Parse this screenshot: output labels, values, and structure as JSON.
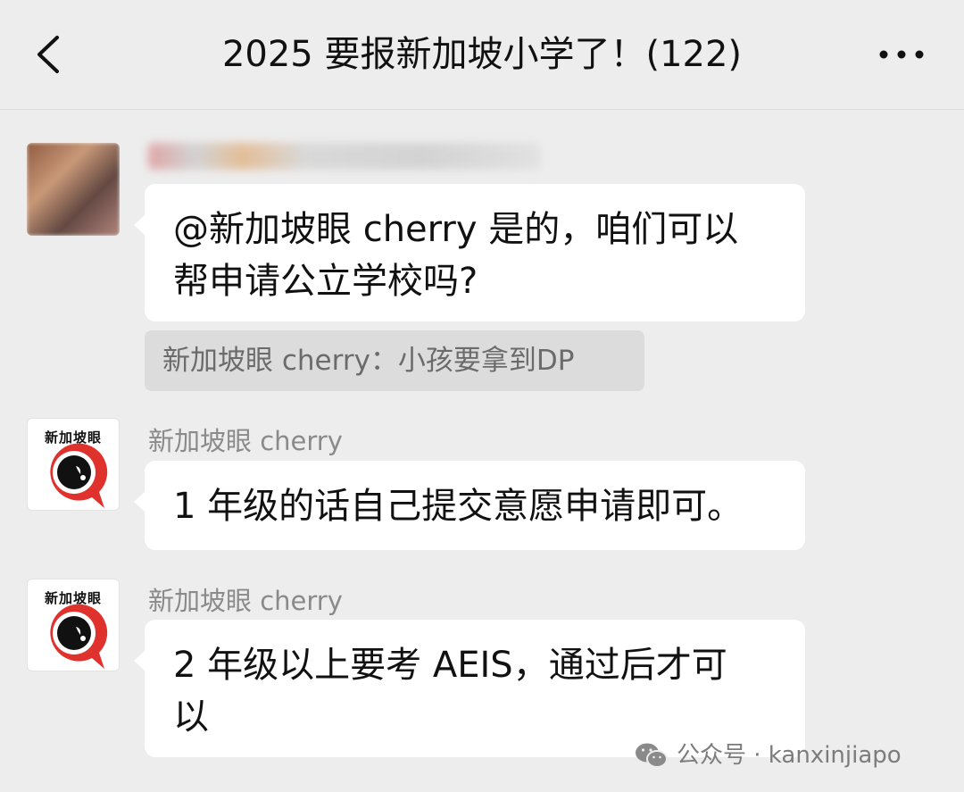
{
  "header": {
    "title": "2025 要报新加坡小学了！(122)"
  },
  "messages": [
    {
      "sender": "",
      "text_line1": "@新加坡眼 cherry 是的，咱们可以",
      "text_line2": "帮申请公立学校吗?",
      "quote": "新加坡眼 cherry：小孩要拿到DP"
    },
    {
      "sender": "新加坡眼 cherry",
      "avatar_text": "新加坡眼",
      "text_line1": "1 年级的话自己提交意愿申请即可。"
    },
    {
      "sender": "新加坡眼 cherry",
      "avatar_text": "新加坡眼",
      "text_line1": "2 年级以上要考 AEIS，通过后才可",
      "text_line2": "以"
    }
  ],
  "watermark": {
    "text": "公众号 · kanxinjiapo"
  },
  "icons": {
    "back": "chevron-left-icon",
    "more": "more-dots-icon",
    "wechat": "wechat-icon"
  },
  "colors": {
    "background": "#ededed",
    "bubble": "#ffffff",
    "quote_bg": "#dcdcdc",
    "brand_red": "#e0322d"
  }
}
